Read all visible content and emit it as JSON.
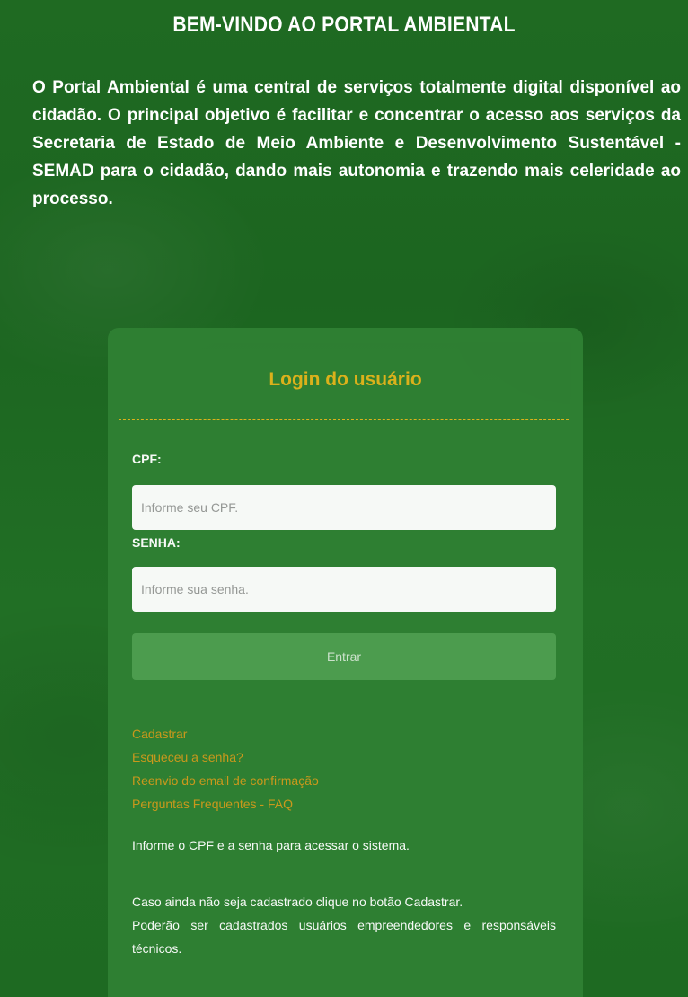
{
  "header": {
    "title": "BEM-VINDO AO PORTAL AMBIENTAL"
  },
  "intro": {
    "text": "O Portal Ambiental é uma central de serviços totalmente digital disponível ao cidadão. O principal objetivo é facilitar e concentrar o acesso aos serviços da Secretaria de Estado de Meio Ambiente e Desenvolvimento Sustentável - SEMAD para o cidadão, dando mais autonomia e trazendo mais celeridade ao processo."
  },
  "login": {
    "title": "Login do usuário",
    "cpf_label": "CPF:",
    "cpf_placeholder": "Informe seu CPF.",
    "password_label": "SENHA:",
    "password_placeholder": "Informe sua senha.",
    "submit_label": "Entrar"
  },
  "links": {
    "register": "Cadastrar",
    "forgot_password": "Esqueceu a senha?",
    "resend_email": "Reenvio do email de confirmação",
    "faq": "Perguntas Frequentes - FAQ"
  },
  "info": {
    "instructions": "Informe o CPF e a senha para acessar o sistema.",
    "not_registered": "Caso ainda não seja cadastrado clique no botão Cadastrar.",
    "who_can_register": "Poderão ser cadastrados usuários empreendedores e responsáveis técnicos."
  },
  "colors": {
    "background": "#1f6a22",
    "card": "#2f8033",
    "accent": "#e3b51b",
    "link": "#d19a1c",
    "button": "#4e9e50"
  }
}
